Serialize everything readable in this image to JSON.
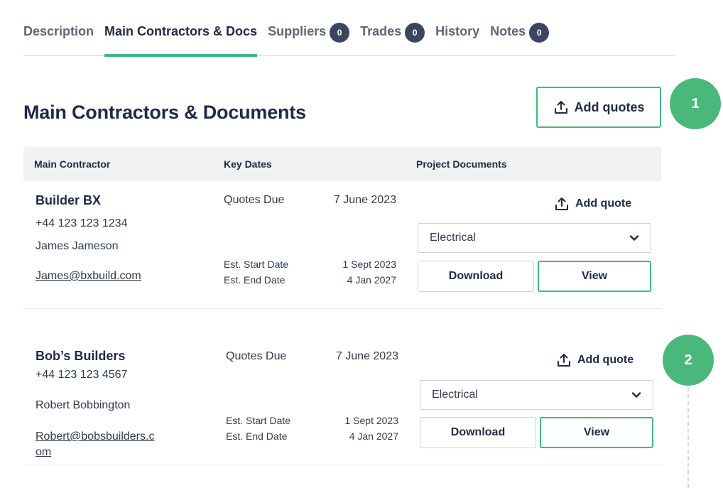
{
  "tabs": [
    {
      "label": "Description",
      "badge": null,
      "active": false
    },
    {
      "label": "Main Contractors & Docs",
      "badge": null,
      "active": true
    },
    {
      "label": "Suppliers",
      "badge": "0",
      "active": false
    },
    {
      "label": "Trades",
      "badge": "0",
      "active": false
    },
    {
      "label": "History",
      "badge": null,
      "active": false
    },
    {
      "label": "Notes",
      "badge": "0",
      "active": false
    }
  ],
  "page": {
    "title": "Main Contractors & Documents",
    "add_quotes_label": "Add quotes"
  },
  "steps": [
    "1",
    "2"
  ],
  "table": {
    "headers": [
      "Main Contractor",
      "Key Dates",
      "Project Documents"
    ]
  },
  "contractors": [
    {
      "name": "Builder BX",
      "phone": "+44 123 123 1234",
      "contact": "James Jameson",
      "email": "James@bxbuild.com",
      "quotes_due_label": "Quotes Due",
      "quotes_due": "7 June 2023",
      "start_label": "Est. Start Date",
      "start_date": "1 Sept 2023",
      "end_label": "Est. End Date",
      "end_date": "4 Jan 2027",
      "add_quote_label": "Add quote",
      "doc_type": "Electrical",
      "download_label": "Download",
      "view_label": "View"
    },
    {
      "name": "Bob’s Builders",
      "phone": "+44 123 123 4567",
      "contact": "Robert Bobbington",
      "email": "Robert@bobsbuilders.com",
      "quotes_due_label": "Quotes Due",
      "quotes_due": "7 June 2023",
      "start_label": "Est. Start Date",
      "start_date": "1 Sept 2023",
      "end_label": "Est. End Date",
      "end_date": "4 Jan 2027",
      "add_quote_label": "Add quote",
      "doc_type": "Electrical",
      "download_label": "Download",
      "view_label": "View"
    }
  ],
  "colors": {
    "accent": "#3dbb7c",
    "badge": "#3a4560",
    "step_marker": "#4ab87a",
    "text": "#1f2a44"
  },
  "icons": [
    "upload-icon",
    "chevron-down-icon"
  ]
}
